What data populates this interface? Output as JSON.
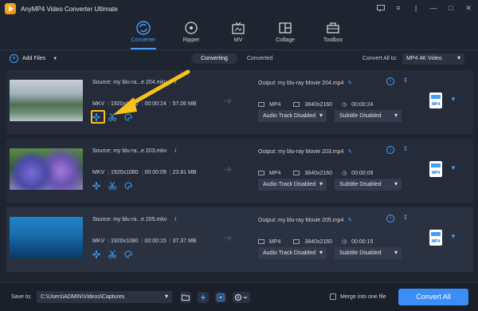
{
  "window": {
    "title": "AnyMP4 Video Converter Ultimate"
  },
  "nav": {
    "tabs": [
      {
        "label": "Converter"
      },
      {
        "label": "Ripper"
      },
      {
        "label": "MV"
      },
      {
        "label": "Collage"
      },
      {
        "label": "Toolbox"
      }
    ]
  },
  "toolbar": {
    "add_files": "Add Files",
    "converting": "Converting",
    "converted": "Converted",
    "convert_all_label": "Convert All to:",
    "convert_all_value": "MP4 4K Video"
  },
  "items": [
    {
      "source": "Source: my blu-ra...e 204.mkv",
      "format": "MKV",
      "resolution": "1920x1080",
      "duration": "00:00:24",
      "size": "57.06 MB",
      "output": "Output: my blu-ray Movie 204.mp4",
      "out_format": "MP4",
      "out_resolution": "3840x2160",
      "out_duration": "00:00:24",
      "audio": "Audio Track Disabled",
      "subtitle": "Subtitle Disabled",
      "badge": "MP4"
    },
    {
      "source": "Source: my blu-ra...e 203.mkv",
      "format": "MKV",
      "resolution": "1920x1080",
      "duration": "00:00:09",
      "size": "23.81 MB",
      "output": "Output: my blu-ray Movie 203.mp4",
      "out_format": "MP4",
      "out_resolution": "3840x2160",
      "out_duration": "00:00:09",
      "audio": "Audio Track Disabled",
      "subtitle": "Subtitle Disabled",
      "badge": "MP4"
    },
    {
      "source": "Source: my blu-ra...e 205.mkv",
      "format": "MKV",
      "resolution": "1920x1080",
      "duration": "00:00:15",
      "size": "37.37 MB",
      "output": "Output: my blu-ray Movie 205.mp4",
      "out_format": "MP4",
      "out_resolution": "3840x2160",
      "out_duration": "00:00:15",
      "audio": "Audio Track Disabled",
      "subtitle": "Subtitle Disabled",
      "badge": "MP4"
    }
  ],
  "bottom": {
    "save_to": "Save to:",
    "path": "C:\\Users\\ADMIN\\Videos\\Captures",
    "merge": "Merge into one file",
    "convert_all": "Convert All"
  },
  "colors": {
    "accent": "#3a8ef6",
    "highlight": "#f8c21b"
  }
}
